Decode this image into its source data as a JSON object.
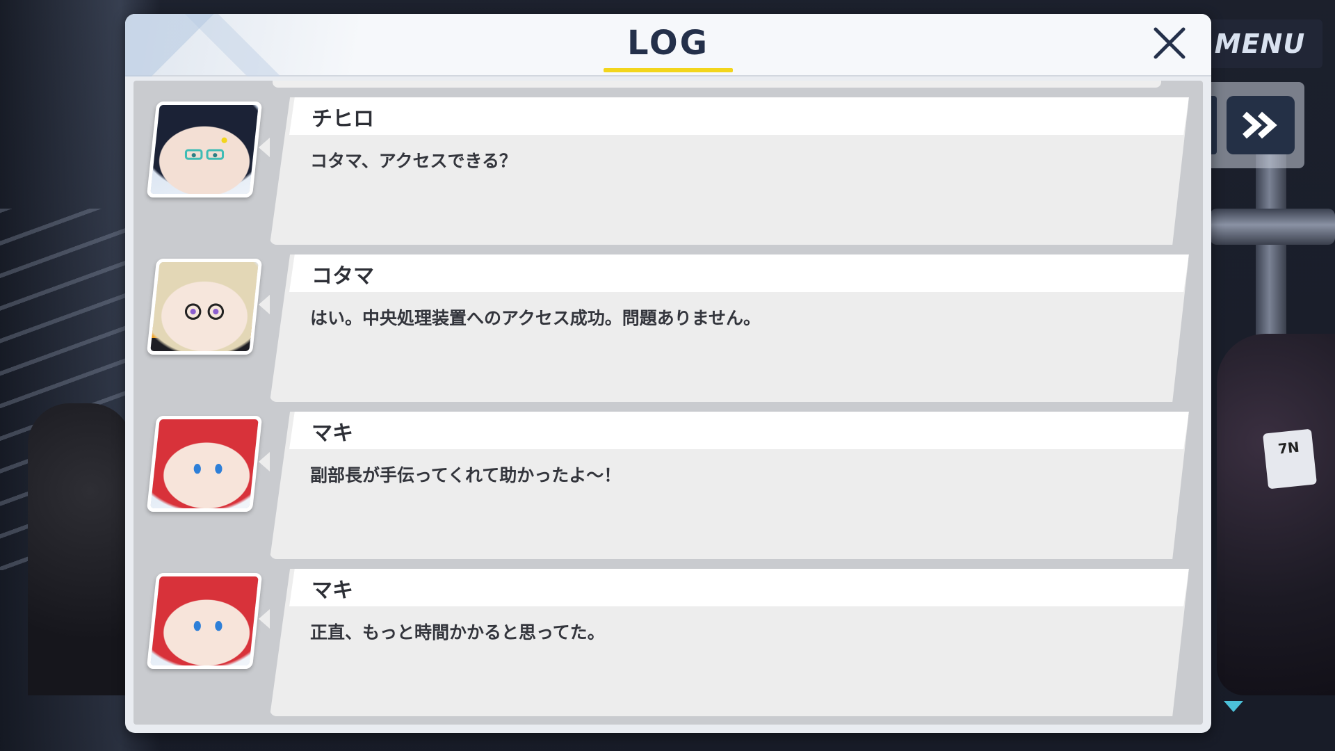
{
  "hud": {
    "menu_label": "MENU",
    "skip_icon": "double-chevron-right-icon"
  },
  "log": {
    "title": "LOG",
    "close_icon": "close-icon",
    "accent_color": "#f2d51c",
    "entries": [
      {
        "speaker": "チヒロ",
        "text": "コタマ、アクセスできる？",
        "portrait": "chihiro"
      },
      {
        "speaker": "コタマ",
        "text": "はい。中央処理装置へのアクセス成功。問題ありません。",
        "portrait": "kotama"
      },
      {
        "speaker": "マキ",
        "text": "副部長が手伝ってくれて助かったよ～！",
        "portrait": "maki"
      },
      {
        "speaker": "マキ",
        "text": "正直、もっと時間かかると思ってた。",
        "portrait": "maki"
      }
    ]
  }
}
